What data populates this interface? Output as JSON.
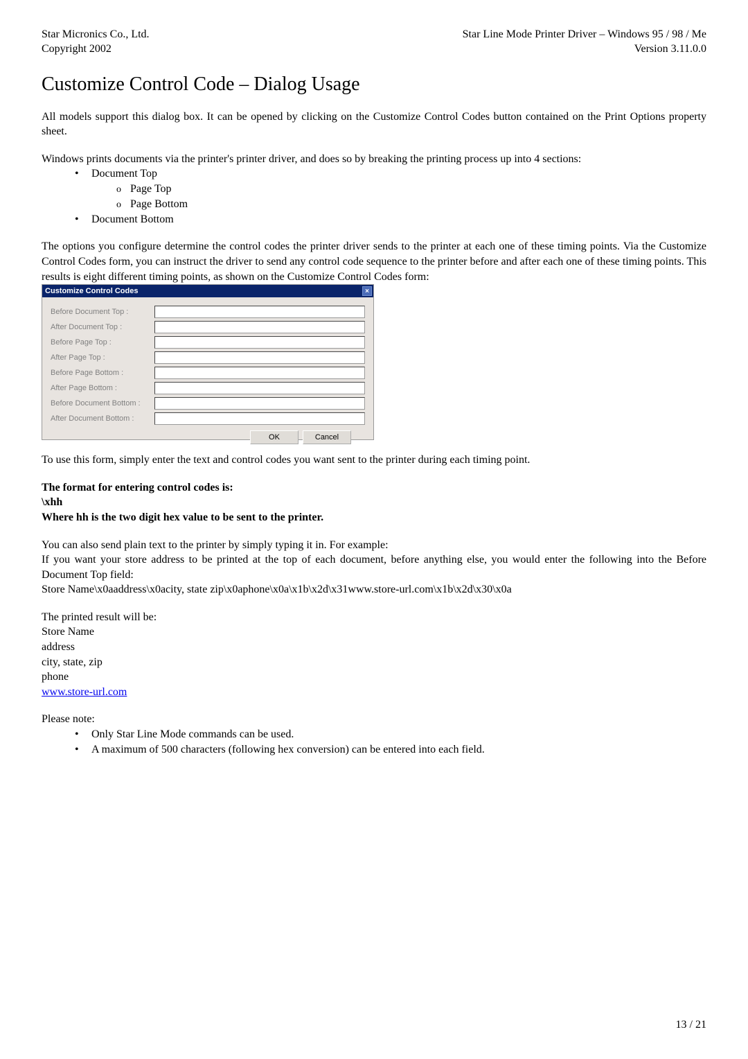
{
  "header": {
    "company": "Star Micronics Co., Ltd.",
    "copyright": "Copyright 2002",
    "product": "Star Line Mode Printer Driver – Windows 95 / 98 / Me",
    "version": "Version 3.11.0.0"
  },
  "title": "Customize Control Code – Dialog Usage",
  "para1": "All models support this dialog box.  It can be opened by clicking on the Customize Control Codes button contained on the Print Options property sheet.",
  "para2": "Windows prints documents via the printer's printer driver, and does so by breaking the printing process up into 4 sections:",
  "bullets_top": {
    "doc_top": "Document Top",
    "page_top": "Page Top",
    "page_bottom": "Page Bottom",
    "doc_bottom": "Document Bottom"
  },
  "para3": "The options you configure determine the control codes the printer driver sends to the printer at each one of these timing points.  Via the Customize Control Codes form, you can instruct the driver to send any control code sequence to the printer before and after each one of these timing points.  This results is eight different timing points, as shown on the Customize Control Codes form:",
  "dialog": {
    "title": "Customize Control Codes",
    "labels": {
      "before_doc_top": "Before Document Top :",
      "after_doc_top": "After Document Top :",
      "before_page_top": "Before Page Top :",
      "after_page_top": "After Page Top :",
      "before_page_bottom": "Before Page Bottom :",
      "after_page_bottom": "After Page Bottom :",
      "before_doc_bottom": "Before Document Bottom :",
      "after_doc_bottom": "After Document Bottom :"
    },
    "ok_label": "OK",
    "cancel_label": "Cancel"
  },
  "para4": "To use this form, simply enter the text and control codes you want sent to the printer during each timing point.",
  "format_heading": "The format for entering control codes is:",
  "format_code": "\\xhh",
  "format_where": "Where hh is the two digit hex value to be sent to the printer.",
  "para5": "You can also send plain text to the printer by simply typing it in.  For example:",
  "para6": "If you want your store address to be printed at the top of each document, before anything else, you would enter the following into the Before Document Top field:",
  "example_input": "Store Name\\x0aaddress\\x0acity, state zip\\x0aphone\\x0a\\x1b\\x2d\\x31www.store-url.com\\x1b\\x2d\\x30\\x0a",
  "result_heading": "The printed result will be:",
  "result_lines": {
    "l1": "Store Name",
    "l2": "address",
    "l3": "city, state, zip",
    "l4": "phone",
    "l5": "www.store-url.com"
  },
  "please_note": "Please note:",
  "notes": {
    "n1": "Only Star Line Mode commands can be used.",
    "n2": "A maximum of 500 characters (following hex conversion) can be entered into each field."
  },
  "footer": "13 / 21"
}
